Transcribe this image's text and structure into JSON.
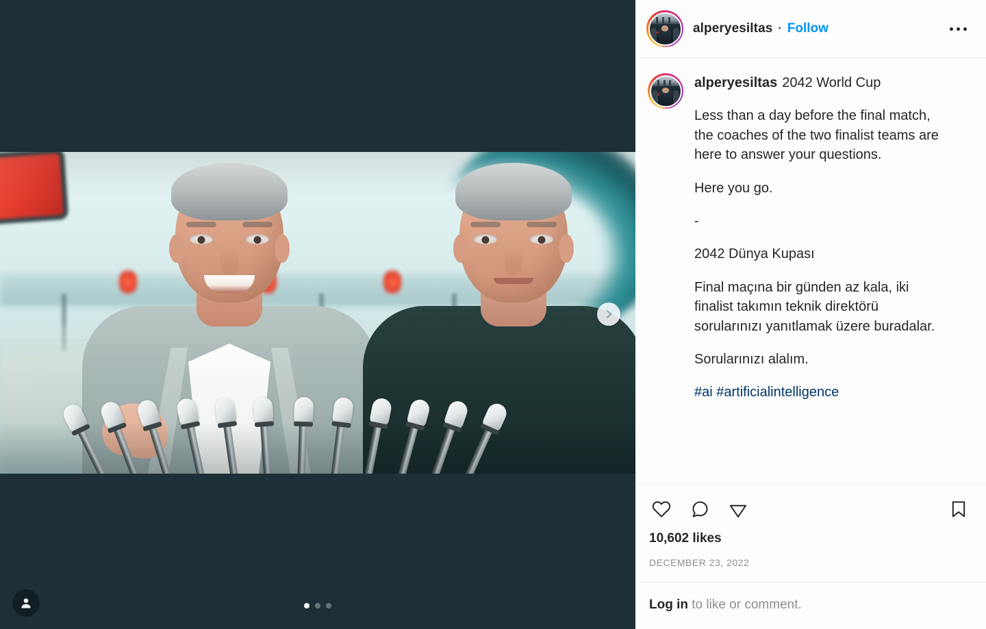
{
  "window": {
    "background_color": "#1c3036"
  },
  "media": {
    "alt": "Two men in suits at a press conference behind a row of microphones",
    "next_icon": "chevron-right-icon",
    "profile_badge_icon": "person-icon",
    "carousel": {
      "total": 3,
      "active_index": 0
    }
  },
  "post": {
    "header": {
      "username": "alperyesiltas",
      "separator": "·",
      "follow_label": "Follow",
      "more_icon": "ellipsis-icon",
      "avatar_name": "profile-avatar"
    },
    "caption": {
      "username": "alperyesiltas",
      "title": "2042 World Cup",
      "paragraphs": [
        "Less than a day before the final match, the coaches of the two finalist teams are here to answer your questions.",
        "Here you go.",
        "-",
        "2042 Dünya Kupası",
        "Final maçına bir günden az kala, iki finalist takımın teknik dirеktörü sorularınızı yanıtlamak üzere buradalar.",
        "Sorularınızı alalım."
      ],
      "hashtags": "#ai #artificialintelligence"
    },
    "actions": {
      "like_icon": "heart-icon",
      "comment_icon": "comment-icon",
      "share_icon": "share-paper-plane-icon",
      "save_icon": "bookmark-icon"
    },
    "likes": "10,602 likes",
    "timestamp": "DECEMBER 23, 2022",
    "footer": {
      "login_label": "Log in",
      "rest": " to like or comment."
    }
  },
  "colors": {
    "link_blue": "#0095f6",
    "hashtag_blue": "#00376b",
    "text_primary": "#262626",
    "text_muted": "#8e8e8e",
    "panel_bg": "#fdfdfd",
    "media_bg": "#1c3036"
  }
}
